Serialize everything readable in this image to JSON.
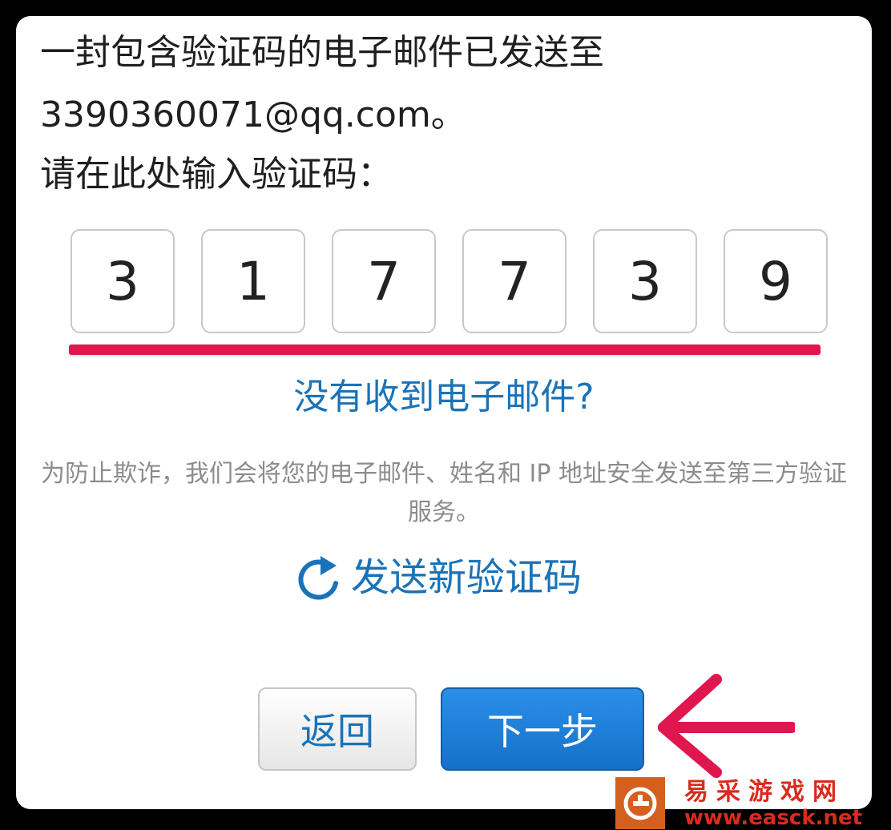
{
  "message": {
    "line1": "一封包含验证码的电子邮件已发送至",
    "line2": "3390360071@qq.com。",
    "line3": "请在此处输入验证码："
  },
  "code_digits": [
    "3",
    "1",
    "7",
    "7",
    "3",
    "9"
  ],
  "links": {
    "no_email": "没有收到电子邮件?",
    "resend": "发送新验证码"
  },
  "privacy_notice": "为防止欺诈，我们会将您的电子邮件、姓名和 IP 地址安全发送至第三方验证服务。",
  "buttons": {
    "back": "返回",
    "next": "下一步"
  },
  "watermark": {
    "name": "易采游戏网",
    "url": "www.easck.net"
  },
  "colors": {
    "link_blue": "#1a73b8",
    "primary_button": "#1f80d8",
    "annotation_red": "#e0164f",
    "watermark_orange": "#d4601f",
    "watermark_red": "#d92b1c"
  },
  "icons": {
    "resend": "refresh-icon",
    "annotation": "arrow-left-icon",
    "watermark": "logo-icon"
  }
}
